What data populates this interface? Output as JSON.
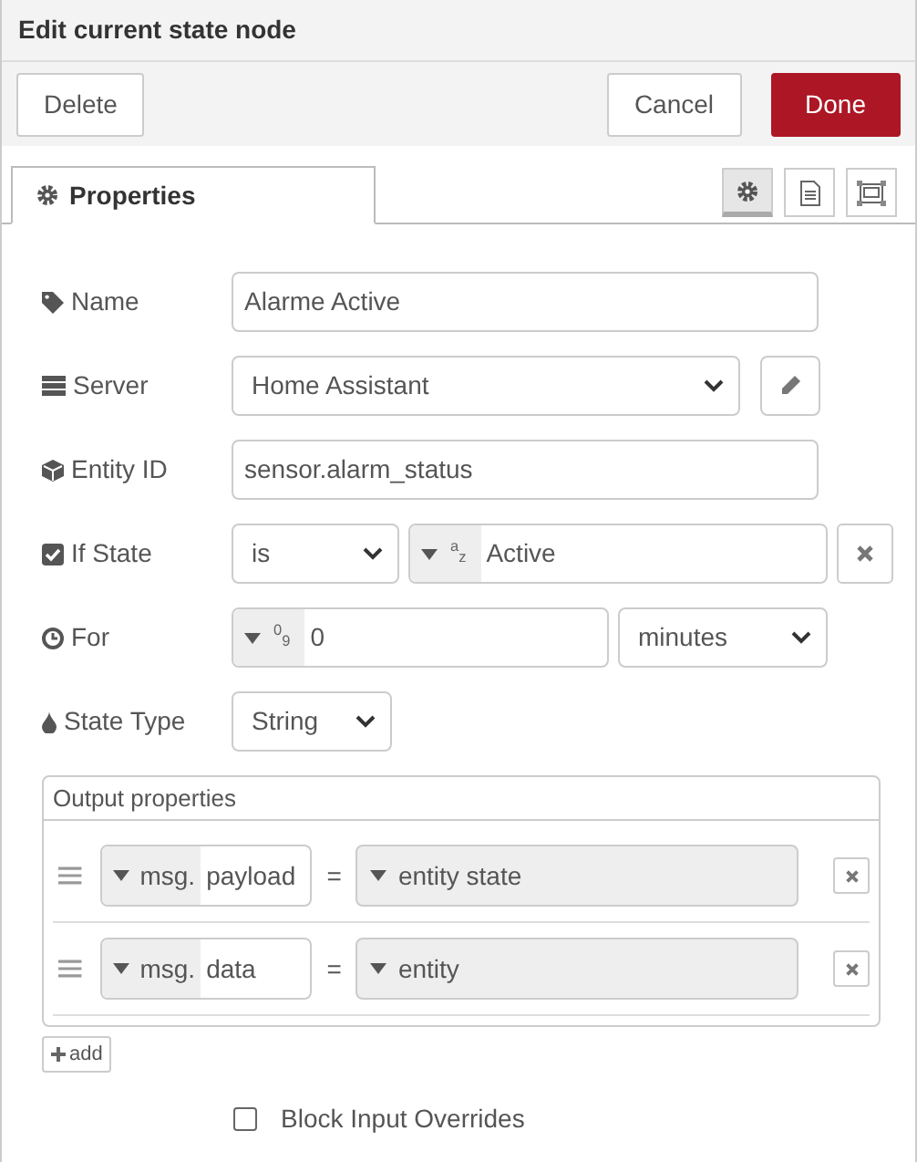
{
  "window": {
    "title": "Edit current state node"
  },
  "toolbar": {
    "buttons": [
      {
        "label": "Delete",
        "kind": "secondary"
      },
      {
        "label": "Cancel",
        "kind": "secondary"
      },
      {
        "label": "Done",
        "kind": "primary"
      }
    ]
  },
  "tabs": [
    {
      "label": "Properties",
      "selected": true
    }
  ],
  "tab_buttons": [
    {
      "kind": "gear",
      "selected": true
    },
    {
      "kind": "document",
      "selected": false
    },
    {
      "kind": "frame",
      "selected": false
    }
  ],
  "name": {
    "label": "Name",
    "value": "Alarme Active"
  },
  "server": {
    "label": "Server",
    "value": "Home Assistant"
  },
  "entity_id": {
    "label": "Entity ID",
    "value": "sensor.alarm_status"
  },
  "if_state": {
    "label": "If State",
    "operator": "is",
    "type_label": "$^{a}$$_{z}$",
    "value": "Active"
  },
  "for": {
    "label": "For",
    "type_label": "$^{0}$$_{9}$",
    "value": "0",
    "unit": "minutes"
  },
  "state_type": {
    "label": "State Type",
    "value": "String"
  },
  "output_properties": {
    "title": "Output properties",
    "rows": [
      {
        "prefix": "msg.",
        "property": "payload",
        "operator": "=",
        "value": "entity state"
      },
      {
        "prefix": "msg.",
        "property": "data",
        "operator": "=",
        "value": "entity"
      }
    ],
    "add_label": "add"
  },
  "block_input_overrides": {
    "label": "Block Input Overrides",
    "checked": false
  }
}
